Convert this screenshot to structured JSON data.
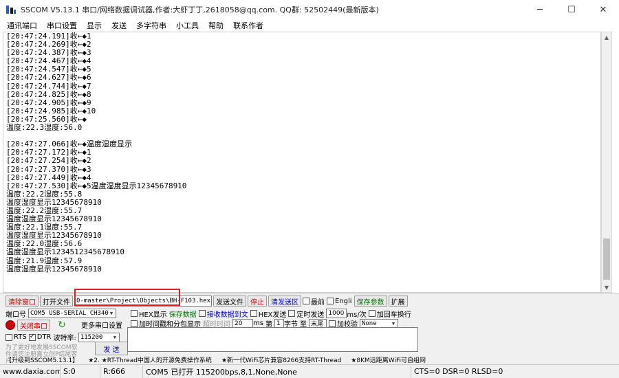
{
  "window": {
    "title": "SSCOM V5.13.1 串口/网络数据调试器,作者:大虾丁丁,2618058@qq.com. QQ群: 52502449(最新版本)",
    "minimize": "─",
    "maximize": "☐",
    "close": "✕"
  },
  "menu": [
    "通讯端口",
    "串口设置",
    "显示",
    "发送",
    "多字符串",
    "小工具",
    "帮助",
    "联系作者"
  ],
  "receive_lines": [
    "[20:47:24.191]收←◆1",
    "[20:47:24.269]收←◆2",
    "[20:47:24.387]收←◆3",
    "[20:47:24.467]收←◆4",
    "[20:47:24.547]收←◆5",
    "[20:47:24.627]收←◆6",
    "[20:47:24.744]收←◆7",
    "[20:47:24.825]收←◆8",
    "[20:47:24.905]收←◆9",
    "[20:47:24.985]收←◆10",
    "[20:47:25.560]收←◆",
    "温度:22.3湿度:56.0",
    "",
    "[20:47:27.066]收←◆温度湿度显示",
    "[20:47:27.172]收←◆1",
    "[20:47:27.254]收←◆2",
    "[20:47:27.370]收←◆3",
    "[20:47:27.449]收←◆4",
    "[20:47:27.530]收←◆5温度湿度显示12345678910",
    "温度:22.2湿度:55.8",
    "温度湿度显示12345678910",
    "温度:22.2湿度:55.7",
    "温度湿度显示12345678910",
    "温度:22.1湿度:55.7",
    "温度湿度显示12345678910",
    "温度:22.0湿度:56.6",
    "温度湿度显示1234512345678910",
    "温度:21.9湿度:57.9",
    "温度湿度显示12345678910"
  ],
  "toolbar": {
    "clear_window": "清除窗口",
    "open_file": "打开文件",
    "file_path": "0-master\\Project\\Objects\\BH-F103.hex",
    "send_file": "发送文件",
    "stop": "停止",
    "clear_send": "清发送区",
    "topmost": "最前",
    "english": "Engli",
    "save_params": "保存参数",
    "expand": "扩展"
  },
  "port": {
    "port_label": "端口号",
    "port_value": "COM5 USB-SERIAL CH340",
    "close_port": "关闭串口",
    "more_settings": "更多串口设置",
    "rts": "RTS",
    "dtr": "DTR",
    "baud_label": "波特率:",
    "baud_value": "115200"
  },
  "options": {
    "hex_display": "HEX显示",
    "save_data": "保存数据",
    "recv_to_file": "接收数据到文",
    "hex_send": "HEX发送",
    "timed_send": "定时发送",
    "interval_value": "1000",
    "interval_unit": "ms/次",
    "add_newline": "加回车换行",
    "timestamp": "加时间戳和分包显示",
    "timeout_label": "超时时间",
    "timeout_value": "20",
    "timeout_unit": "ms",
    "nth_label": "第",
    "nth_value": "1",
    "byte_label": "字节",
    "to_label": "至",
    "end_value": "末尾",
    "checksum_label": "加校验",
    "checksum_value": "None"
  },
  "send": {
    "ad_text": "为了更好地发展SSCOM软件请您注册嘉立创P结尾客户",
    "send_button": "发 送"
  },
  "ticker": [
    "【升级到SSCOM5.13.1】",
    "★2. ★RT-Thread中国人的开源免费操作系统",
    "★新一代WiFi芯片兼容8266支持RT-Thread",
    "★8KM远距离WiFi可自组网"
  ],
  "status": {
    "site": "www.daxia.com",
    "sent": "S:0",
    "received": "R:666",
    "port_state": "COM5 已打开  115200bps,8,1,None,None",
    "lines": "CTS=0 DSR=0 RLSD=0"
  }
}
